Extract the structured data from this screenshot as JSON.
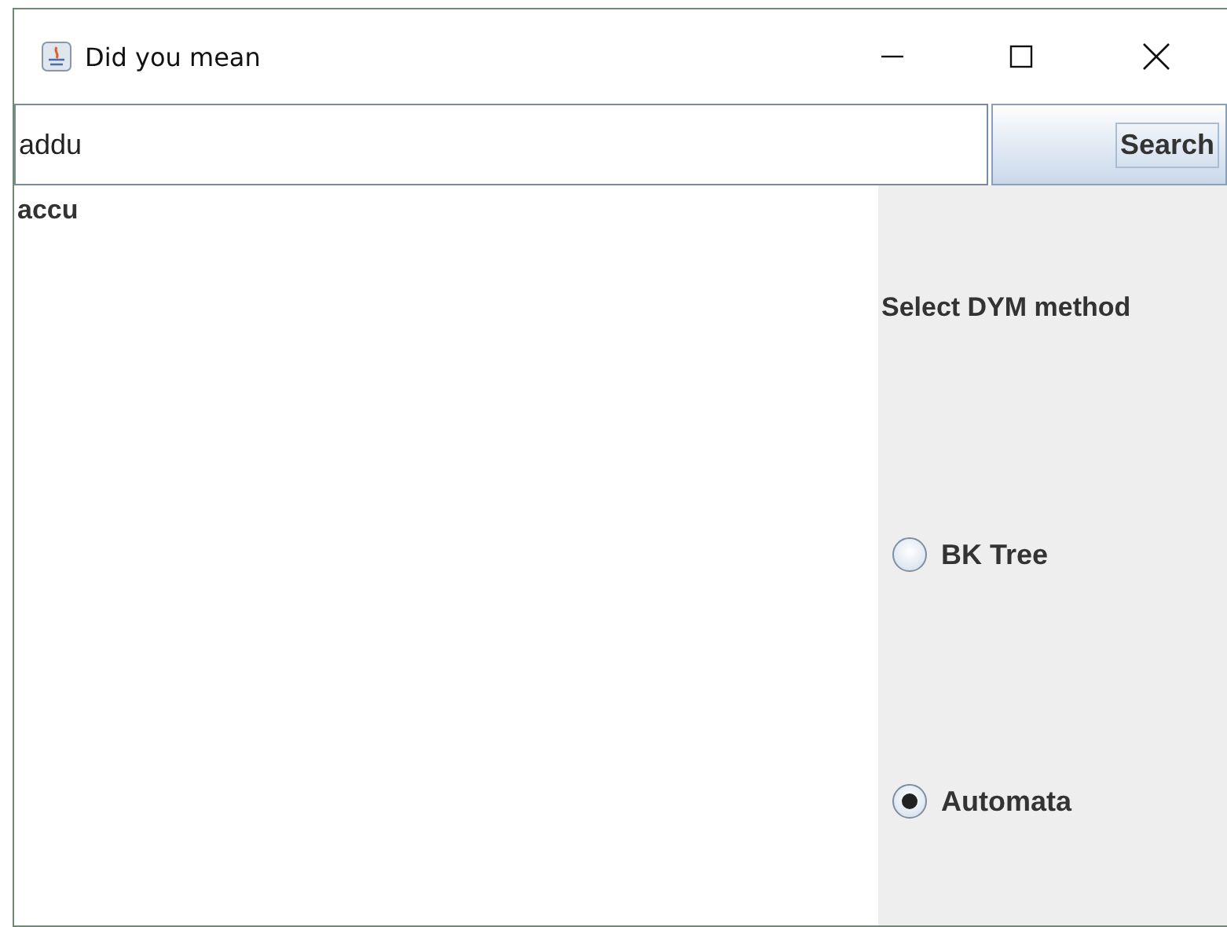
{
  "window": {
    "title": "Did you mean"
  },
  "search": {
    "value": "addu",
    "button": "Search"
  },
  "results": [
    "accu"
  ],
  "method_panel": {
    "label": "Select DYM method",
    "options": [
      {
        "label": "BK Tree",
        "selected": false
      },
      {
        "label": "Automata",
        "selected": true
      }
    ]
  }
}
